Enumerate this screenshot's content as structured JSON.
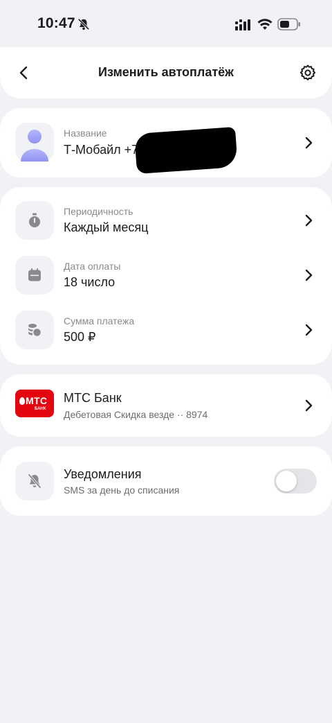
{
  "status_bar": {
    "time": "10:47"
  },
  "header": {
    "title": "Изменить автоплатёж"
  },
  "name_card": {
    "label": "Название",
    "value": "Т-Мобайл +7"
  },
  "schedule": {
    "items": [
      {
        "label": "Периодичность",
        "value": "Каждый месяц",
        "icon": "timer-icon"
      },
      {
        "label": "Дата оплаты",
        "value": "18 число",
        "icon": "calendar-icon"
      },
      {
        "label": "Сумма платежа",
        "value": "500 ₽",
        "icon": "coins-icon"
      }
    ]
  },
  "bank": {
    "logo_text": "МТС",
    "logo_sub": "БАНК",
    "title": "МТС Банк",
    "subtitle": "Дебетовая Скидка везде ·· 8974",
    "brand_color": "#e30611"
  },
  "notifications": {
    "title": "Уведомления",
    "subtitle": "SMS за день до списания",
    "enabled": false
  },
  "colors": {
    "background": "#f1f2f6",
    "card": "#ffffff",
    "accent": "#8f93f0"
  }
}
